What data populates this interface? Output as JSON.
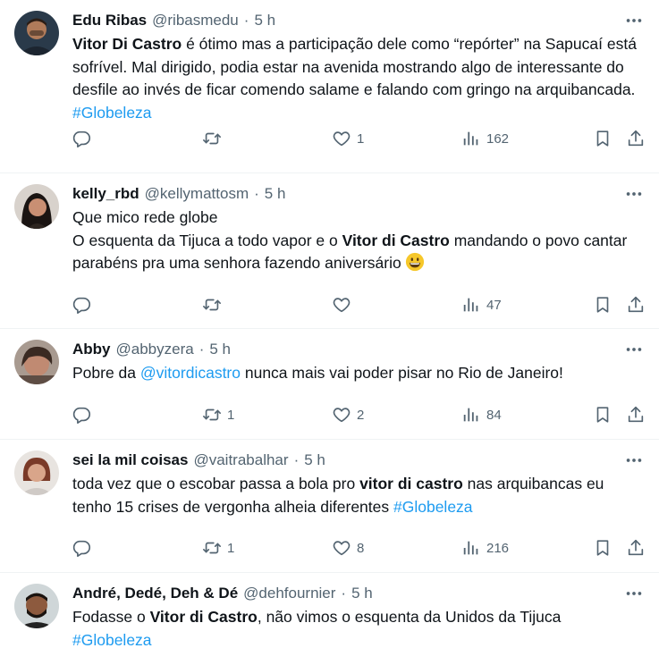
{
  "tweets": [
    {
      "name": "Edu Ribas",
      "handle": "@ribasmedu",
      "time": "5 h",
      "text": [
        {
          "b": "Vitor Di Castro"
        },
        {
          "t": " é ótimo mas a participação dele como “repórter” na Sapucaí está sofrível. Mal dirigido, podia estar na avenida mostrando algo de interessante do desfile ao invés de ficar comendo salame e falando com gringo na arquibancada. "
        },
        {
          "link": "#Globeleza"
        }
      ],
      "replies": "",
      "retweets": "",
      "likes": "1",
      "views": "162"
    },
    {
      "name": "kelly_rbd",
      "handle": "@kellymattosm",
      "time": "5 h",
      "text": [
        {
          "t": "Que mico rede globe\nO esquenta da Tijuca a todo vapor e o "
        },
        {
          "b": "Vitor di Castro"
        },
        {
          "t": " mandando o povo cantar parabéns pra uma senhora fazendo aniversário"
        },
        {
          "emoji": "grinning-face"
        }
      ],
      "replies": "",
      "retweets": "",
      "likes": "",
      "views": "47"
    },
    {
      "name": "Abby",
      "handle": "@abbyzera",
      "time": "5 h",
      "text": [
        {
          "t": "Pobre da "
        },
        {
          "link": "@vitordicastro"
        },
        {
          "t": " nunca mais vai poder pisar no Rio de Janeiro!"
        }
      ],
      "replies": "",
      "retweets": "1",
      "likes": "2",
      "views": "84"
    },
    {
      "name": "sei la mil coisas",
      "handle": "@vaitrabalhar",
      "time": "5 h",
      "text": [
        {
          "t": "toda vez que o escobar passa a bola pro "
        },
        {
          "b": "vitor di castro"
        },
        {
          "t": " nas arquibancas eu tenho 15 crises de vergonha alheia diferentes "
        },
        {
          "link": "#Globeleza"
        }
      ],
      "replies": "",
      "retweets": "1",
      "likes": "8",
      "views": "216"
    },
    {
      "name": "André, Dedé, Deh & Dé",
      "handle": "@dehfournier",
      "time": "5 h",
      "text": [
        {
          "t": "Fodasse o "
        },
        {
          "b": "Vitor di Castro"
        },
        {
          "t": ", não vimos o esquenta da Unidos da Tijuca\n"
        },
        {
          "link": "#Globeleza"
        }
      ],
      "replies": "",
      "retweets": "",
      "likes": "",
      "views": ""
    }
  ],
  "icons": {
    "reply": "reply-icon",
    "retweet": "retweet-icon",
    "like": "heart-icon",
    "views": "views-icon",
    "bookmark": "bookmark-icon",
    "share": "share-icon",
    "more": "more-icon"
  },
  "colors": {
    "link": "#1d9bf0",
    "secondary": "#536471",
    "divider": "#eff3f4"
  }
}
